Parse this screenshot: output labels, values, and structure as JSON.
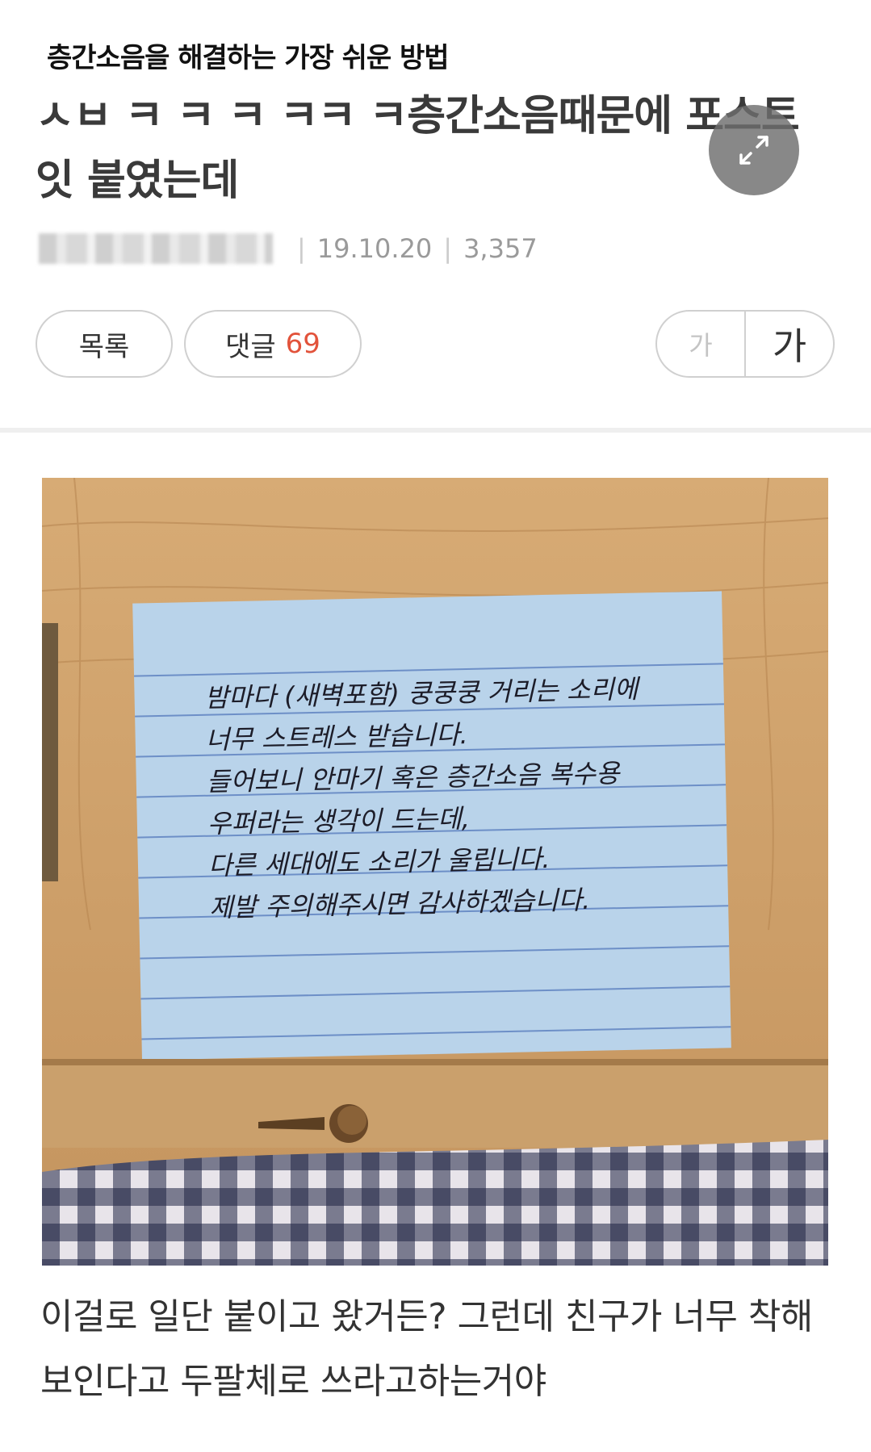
{
  "caption_title": "층간소음을 해결하는 가장 쉬운 방법",
  "post": {
    "title": "ㅅㅂ ㅋ ㅋ ㅋ ㅋㅋ ㅋ층간소음때문에 포스트잇 붙였는데",
    "date": "19.10.20",
    "views": "3,357"
  },
  "buttons": {
    "list_label": "목록",
    "comment_label": "댓글",
    "comment_count": "69",
    "font_small": "가",
    "font_large": "가"
  },
  "image": {
    "note_lines": [
      "밤마다 (새벽포함) 쿵쿵쿵 거리는 소리에",
      "너무 스트레스 받습니다.",
      "들어보니 안마기 혹은 층간소음 복수용",
      "우퍼라는 생각이 드는데,",
      "다른 세대에도 소리가 울립니다.",
      "제발 주의해주시면 감사하겠습니다."
    ]
  },
  "caption": "이걸로 일단 붙이고 왔거든? 그런데 친구가 너무 착해보인다고 두팔체로 쓰라고하는거야",
  "colors": {
    "accent_count": "#e2533b",
    "wood": "#c79b66",
    "note": "#b9d3ea",
    "note_line": "#6d8fc7",
    "gingham_dark": "#1f2544"
  },
  "icons": {
    "expand": "expand-arrows-icon"
  }
}
